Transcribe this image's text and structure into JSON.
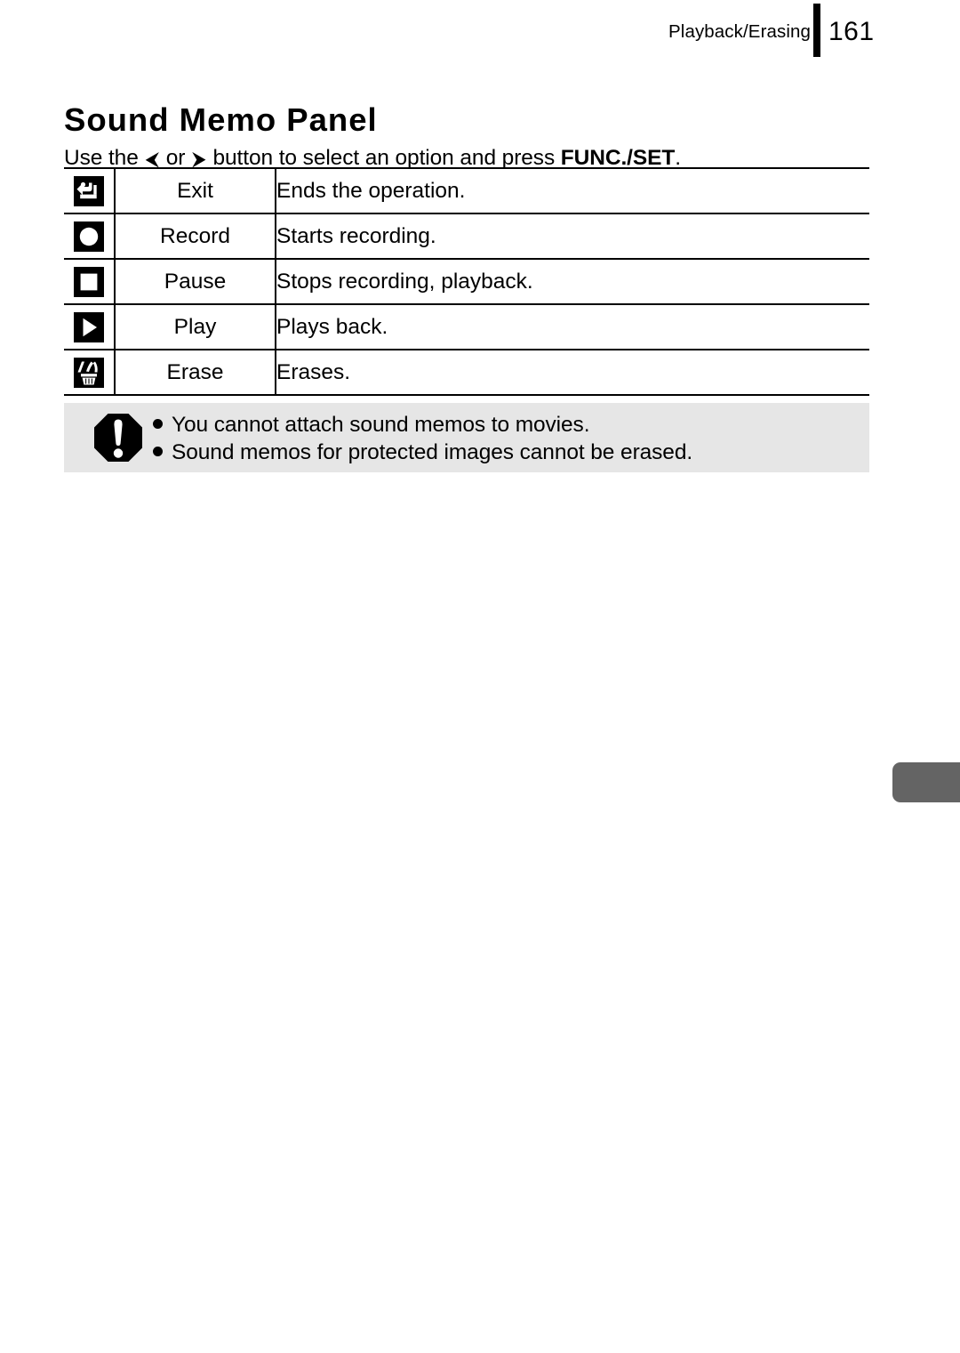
{
  "header": {
    "section": "Playback/Erasing",
    "page_number": "161"
  },
  "title": "Sound Memo Panel",
  "instruction": {
    "prefix": "Use the ",
    "arrow_left": "⮜",
    "middle": " or ",
    "arrow_right": "⮞",
    "suffix": " button to select an option and press ",
    "emphasis": "FUNC./SET",
    "period": "."
  },
  "table": {
    "rows": [
      {
        "icon": "return-arrow-icon",
        "name": "Exit",
        "description": "Ends the operation."
      },
      {
        "icon": "record-circle-icon",
        "name": "Record",
        "description": "Starts recording."
      },
      {
        "icon": "stop-square-icon",
        "name": "Pause",
        "description": "Stops recording, playback."
      },
      {
        "icon": "play-triangle-icon",
        "name": "Play",
        "description": "Plays back."
      },
      {
        "icon": "trash-erase-icon",
        "name": "Erase",
        "description": "Erases."
      }
    ]
  },
  "note": {
    "icon": "exclamation-octagon-icon",
    "items": [
      "You cannot attach sound memos to movies.",
      "Sound memos for protected images cannot be erased."
    ]
  },
  "colors": {
    "note_background": "#e6e6e6",
    "thumb_tab": "#646464",
    "ink": "#000000"
  }
}
